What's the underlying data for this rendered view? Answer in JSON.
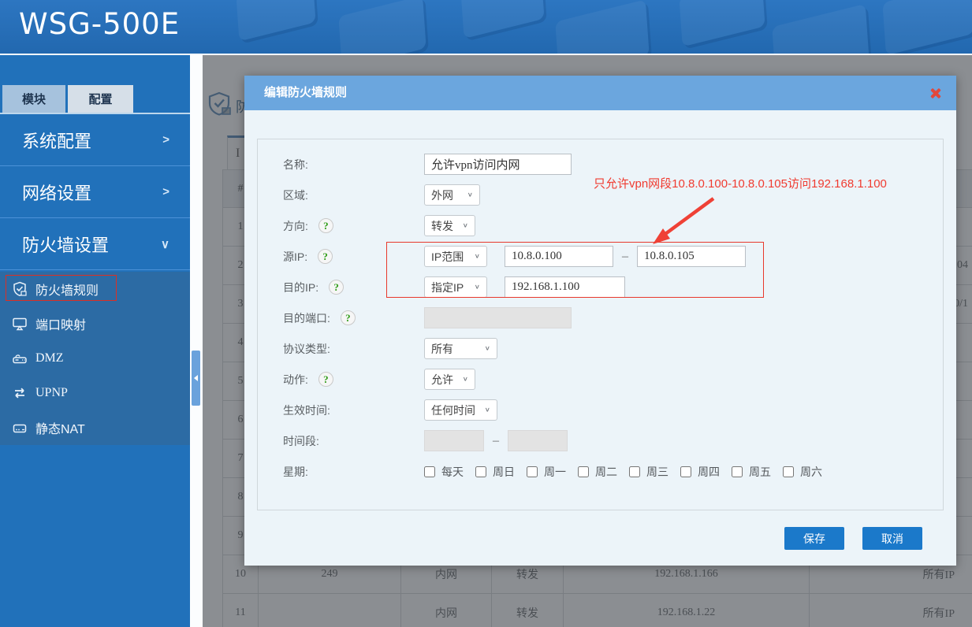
{
  "banner": {
    "title": "WSG-500E"
  },
  "sidebar": {
    "tabs": {
      "module": "模块",
      "config": "配置"
    },
    "menu": [
      {
        "label": "系统配置",
        "chevron": ">"
      },
      {
        "label": "网络设置",
        "chevron": ">"
      },
      {
        "label": "防火墙设置",
        "chevron": "∨"
      }
    ],
    "submenu": [
      {
        "label": "防火墙规则",
        "icon": "shield-check-icon"
      },
      {
        "label": "端口映射",
        "icon": "cast-icon"
      },
      {
        "label": "DMZ",
        "icon": "router-icon"
      },
      {
        "label": "UPNP",
        "icon": "swap-arrows-icon"
      },
      {
        "label": "静态NAT",
        "icon": "drive-icon"
      }
    ]
  },
  "page": {
    "title_fragment": "防",
    "tab_fragment": "I",
    "table": {
      "header_num": "#",
      "rows": [
        {
          "num": "1",
          "name": "",
          "zone": "",
          "dir": "",
          "src": "",
          "dst": ""
        },
        {
          "num": "2",
          "name": "",
          "zone": "",
          "dir": "",
          "src": "",
          "dst": "104"
        },
        {
          "num": "3",
          "name": "",
          "zone": "",
          "dir": "",
          "src": "",
          "dst": "0/1"
        },
        {
          "num": "4",
          "name": "",
          "zone": "",
          "dir": "",
          "src": "",
          "dst": ""
        },
        {
          "num": "5",
          "name": "",
          "zone": "",
          "dir": "",
          "src": "",
          "dst": ""
        },
        {
          "num": "6",
          "name": "",
          "zone": "",
          "dir": "",
          "src": "",
          "dst": ""
        },
        {
          "num": "7",
          "name": "",
          "zone": "",
          "dir": "",
          "src": "",
          "dst": ""
        },
        {
          "num": "8",
          "name": "",
          "zone": "",
          "dir": "",
          "src": "",
          "dst": ""
        },
        {
          "num": "9",
          "name": "",
          "zone": "",
          "dir": "",
          "src": "",
          "dst": ""
        },
        {
          "num": "10",
          "name": "249",
          "zone": "内网",
          "dir": "转发",
          "src": "192.168.1.166",
          "dst": "所有IP"
        },
        {
          "num": "11",
          "name": "",
          "zone": "内网",
          "dir": "转发",
          "src": "192.168.1.22",
          "dst": "所有IP"
        }
      ]
    }
  },
  "modal": {
    "title": "编辑防火墙规则",
    "help_glyph": "?",
    "fields": {
      "name": {
        "label": "名称:",
        "value": "允许vpn访问内网"
      },
      "zone": {
        "label": "区域:",
        "value": "外网"
      },
      "direction": {
        "label": "方向:",
        "value": "转发"
      },
      "src_ip": {
        "label": "源IP:",
        "mode": "IP范围",
        "from": "10.8.0.100",
        "dash": "–",
        "to": "10.8.0.105"
      },
      "dst_ip": {
        "label": "目的IP:",
        "mode": "指定IP",
        "value": "192.168.1.100"
      },
      "dst_port": {
        "label": "目的端口:"
      },
      "protocol": {
        "label": "协议类型:",
        "value": "所有"
      },
      "action": {
        "label": "动作:",
        "value": "允许"
      },
      "effective_time": {
        "label": "生效时间:",
        "value": "任何时间"
      },
      "time_range": {
        "label": "时间段:",
        "dash": "–"
      },
      "week": {
        "label": "星期:",
        "options": [
          "每天",
          "周日",
          "周一",
          "周二",
          "周三",
          "周四",
          "周五",
          "周六"
        ]
      }
    },
    "buttons": {
      "save": "保存",
      "cancel": "取消"
    }
  },
  "annotation": {
    "note": "只允许vpn网段10.8.0.100-10.8.0.105访问192.168.1.100"
  },
  "colors": {
    "sidebar_blue": "#2171ba",
    "modal_header_blue": "#6ba6de",
    "button_blue": "#1b79ca",
    "annotation_red": "#f03b30",
    "help_green": "#2f9c17"
  },
  "icons": {
    "close": "x-icon",
    "collapse": "left-triangle-icon",
    "page_title": "shield-icon"
  }
}
